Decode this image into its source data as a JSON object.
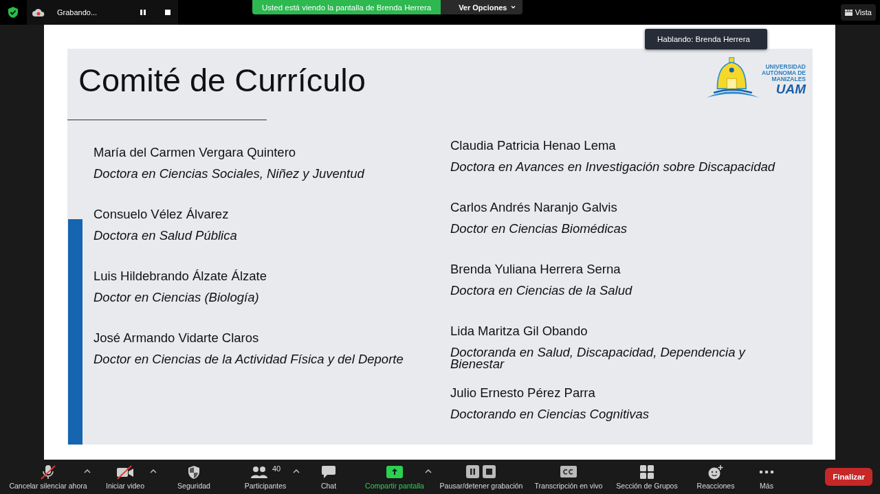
{
  "top_bar": {
    "recording": {
      "label": "Grabando...",
      "paused": false
    },
    "sharing_banner": "Usted está viendo la pantalla de Brenda Herrera",
    "view_options": "Ver Opciones",
    "view_button": "Vista"
  },
  "speaking_tooltip": "Hablando: Brenda Herrera",
  "slide": {
    "title": "Comité de Currículo",
    "logo": {
      "lines": [
        "UNIVERSIDAD",
        "AUTÓNOMA DE",
        "MANIZALES"
      ],
      "acronym": "UAM"
    },
    "columns": [
      [
        {
          "name": "María del Carmen Vergara Quintero",
          "degree": "Doctora en Ciencias Sociales, Niñez y Juventud"
        },
        {
          "name": "Consuelo Vélez Álvarez",
          "degree": "Doctora en Salud Pública"
        },
        {
          "name": "Luis Hildebrando Álzate Álzate",
          "degree": "Doctor en Ciencias (Biología)"
        },
        {
          "name": "José Armando Vidarte Claros",
          "degree": "Doctor en Ciencias de la Actividad Física y del Deporte"
        }
      ],
      [
        {
          "name": "Claudia Patricia Henao Lema",
          "degree": "Doctora en Avances en Investigación sobre Discapacidad"
        },
        {
          "name": "Carlos Andrés Naranjo Galvis",
          "degree": "Doctor en Ciencias Biomédicas"
        },
        {
          "name": "Brenda Yuliana Herrera Serna",
          "degree": "Doctora en Ciencias de la Salud"
        },
        {
          "name": "Lida Maritza Gil Obando",
          "degree": "Doctoranda en Salud, Discapacidad, Dependencia y Bienestar"
        },
        {
          "name": "Julio Ernesto Pérez Parra",
          "degree": "Doctorando en Ciencias Cognitivas"
        }
      ]
    ]
  },
  "toolbar": [
    {
      "kind": "mic",
      "label": "Cancelar silenciar ahora",
      "off": true,
      "has_menu": true,
      "accent": false
    },
    {
      "kind": "video",
      "label": "Iniciar video",
      "off": true,
      "has_menu": true,
      "accent": false
    },
    {
      "kind": "security",
      "label": "Seguridad",
      "has_menu": false,
      "accent": false
    },
    {
      "kind": "participants",
      "label": "Participantes",
      "badge": "40",
      "has_menu": true,
      "accent": false
    },
    {
      "kind": "chat",
      "label": "Chat",
      "has_menu": false,
      "accent": false
    },
    {
      "kind": "share",
      "label": "Compartir pantalla",
      "has_menu": true,
      "accent": true
    },
    {
      "kind": "record",
      "label": "Pausar/detener grabación",
      "has_menu": false,
      "accent": false
    },
    {
      "kind": "cc",
      "label": "Transcripción en vivo",
      "has_menu": false,
      "accent": false
    },
    {
      "kind": "groups",
      "label": "Sección de Grupos",
      "has_menu": false,
      "accent": false
    },
    {
      "kind": "reactions",
      "label": "Reacciones",
      "has_menu": false,
      "accent": false
    },
    {
      "kind": "more",
      "label": "Más",
      "has_menu": false,
      "accent": false
    }
  ],
  "end_button": "Finalizar"
}
